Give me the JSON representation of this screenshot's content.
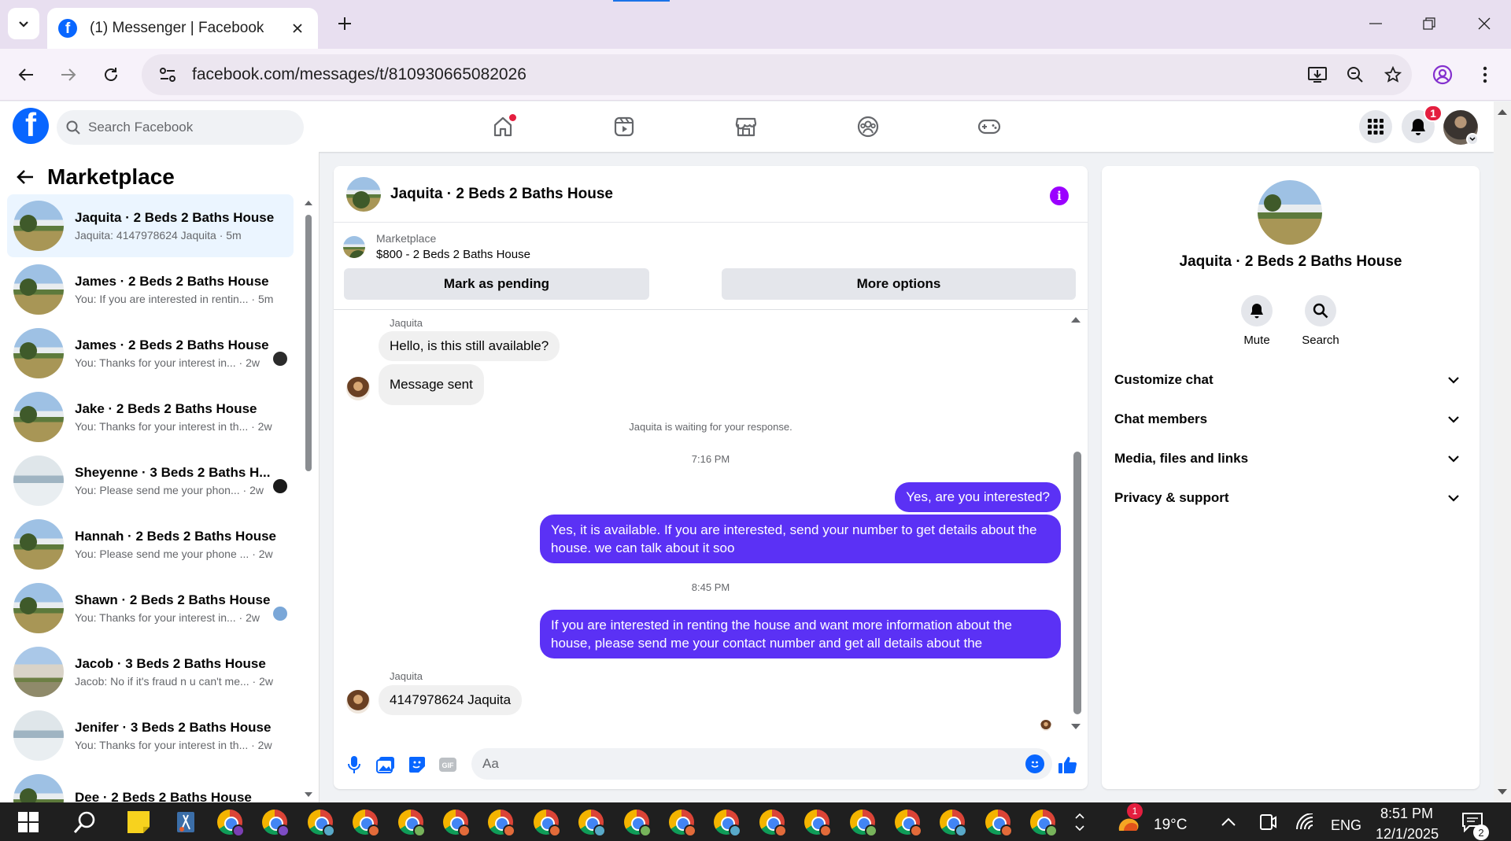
{
  "browser": {
    "tab_title": "(1) Messenger | Facebook",
    "url": "facebook.com/messages/t/810930665082026"
  },
  "fb_header": {
    "search_placeholder": "Search Facebook",
    "notification_count": "1",
    "nav_icons": [
      "home-icon",
      "video-icon",
      "marketplace-icon",
      "groups-icon",
      "gaming-icon"
    ]
  },
  "left": {
    "title": "Marketplace",
    "conversations": [
      {
        "name": "Jaquita · 2 Beds 2 Baths House",
        "preview": "Jaquita: 4147978624 Jaquita · 5m",
        "thumb": "house",
        "active": true
      },
      {
        "name": "James · 2 Beds 2 Baths House",
        "preview": "You: If you are interested in rentin... · 5m",
        "thumb": "house"
      },
      {
        "name": "James · 2 Beds 2 Baths House",
        "preview": "You: Thanks for your interest in... · 2w",
        "thumb": "house"
      },
      {
        "name": "Jake · 2 Beds 2 Baths House",
        "preview": "You: Thanks for your interest in th... · 2w",
        "thumb": "house"
      },
      {
        "name": "Sheyenne · 3 Beds 2 Baths H...",
        "preview": "You: Please send me your phon... · 2w",
        "thumb": "interior"
      },
      {
        "name": "Hannah · 2 Beds 2 Baths House",
        "preview": "You: Please send me your phone ... · 2w",
        "thumb": "house"
      },
      {
        "name": "Shawn · 2 Beds 2 Baths House",
        "preview": "You: Thanks for your interest in... · 2w",
        "thumb": "house"
      },
      {
        "name": "Jacob · 3 Beds 2 Baths House",
        "preview": "Jacob: No if it's fraud n u can't me... · 2w",
        "thumb": "house2"
      },
      {
        "name": "Jenifer · 3 Beds 2 Baths House",
        "preview": "You: Thanks for your interest in th... · 2w",
        "thumb": "interior"
      },
      {
        "name": "Dee · 2 Beds 2 Baths House",
        "preview": "",
        "thumb": "house"
      }
    ]
  },
  "conversation": {
    "title": "Jaquita · 2 Beds 2 Baths House",
    "marketplace_label": "Marketplace",
    "listing": "$800 - 2 Beds 2 Baths House",
    "mark_pending": "Mark as pending",
    "more_options": "More options",
    "sender_1": "Jaquita",
    "msg_in_1": "Hello, is this still available?",
    "msg_in_2": "Message sent",
    "waiting": "Jaquita is waiting for your response.",
    "time_1": "7:16 PM",
    "msg_out_1": "Yes, are you interested?",
    "msg_out_2": "Yes, it is available. If you are interested, send your number to get details about the house. we can talk about it soo",
    "time_2": "8:45 PM",
    "msg_out_3": "If you are interested in renting the house and want more information about the house, please send me your contact number and get all details about the",
    "sender_2": "Jaquita",
    "msg_in_3": "4147978624 Jaquita",
    "composer_placeholder": "Aa"
  },
  "details": {
    "name": "Jaquita · 2 Beds 2 Baths House",
    "mute": "Mute",
    "search": "Search",
    "sections": [
      "Customize chat",
      "Chat members",
      "Media, files and links",
      "Privacy & support"
    ]
  },
  "taskbar": {
    "weather": "19°C",
    "weather_badge": "1",
    "lang": "ENG",
    "time": "8:51 PM",
    "date": "12/1/2025",
    "notif_count": "2"
  },
  "colors": {
    "accent": "#5b31f5",
    "fb_blue": "#0866ff",
    "info_purple": "#9b00ff",
    "badge_red": "#e41e3f"
  }
}
